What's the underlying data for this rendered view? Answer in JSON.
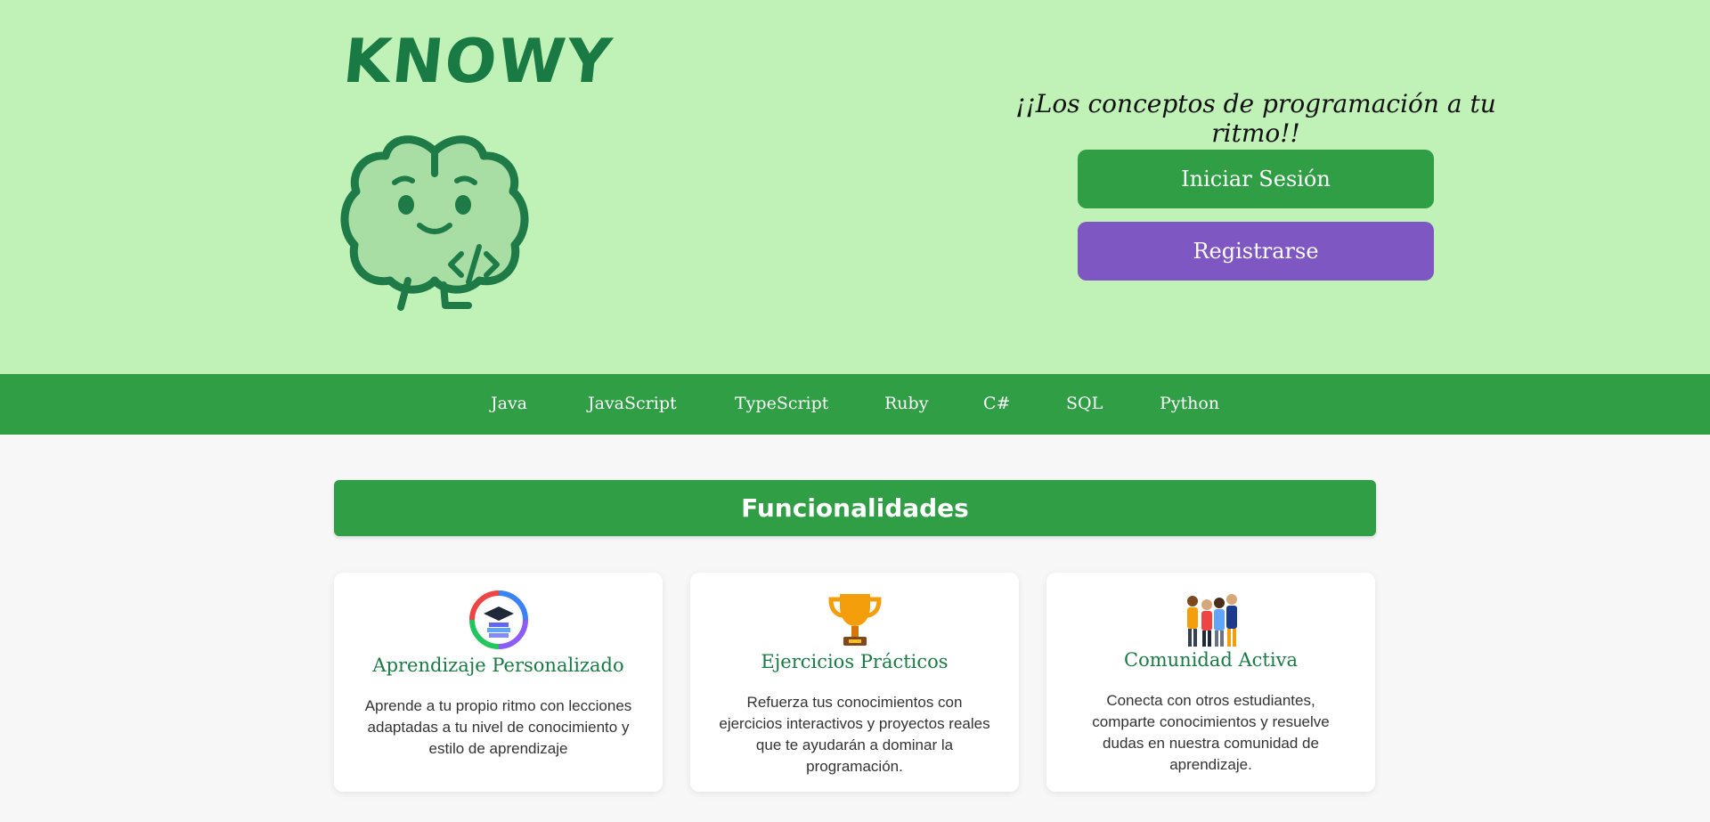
{
  "brand": {
    "name": "KNOWY"
  },
  "hero": {
    "tagline": "¡¡Los conceptos de programación a tu ritmo!!",
    "login_label": "Iniciar Sesión",
    "register_label": "Registrarse"
  },
  "nav": {
    "items": [
      "Java",
      "JavaScript",
      "TypeScript",
      "Ruby",
      "C#",
      "SQL",
      "Python"
    ]
  },
  "features": {
    "title": "Funcionalidades",
    "cards": [
      {
        "title": "Aprendizaje Personalizado",
        "text": "Aprende a tu propio ritmo con lecciones adaptadas a tu nivel de conocimiento y estilo de aprendizaje",
        "icon": "learning-cycle-icon"
      },
      {
        "title": "Ejercicios Prácticos",
        "text": "Refuerza tus conocimientos con ejercicios interactivos y proyectos reales que te ayudarán a dominar la programación.",
        "icon": "trophy-icon"
      },
      {
        "title": "Comunidad Activa",
        "text": "Conecta con otros estudiantes, comparte conocimientos y resuelve dudas en nuestra comunidad de aprendizaje.",
        "icon": "community-icon"
      }
    ]
  },
  "colors": {
    "hero_bg": "#c0f2b8",
    "primary": "#2f9e44",
    "accent": "#7e57c2",
    "brand": "#1a7a44"
  }
}
